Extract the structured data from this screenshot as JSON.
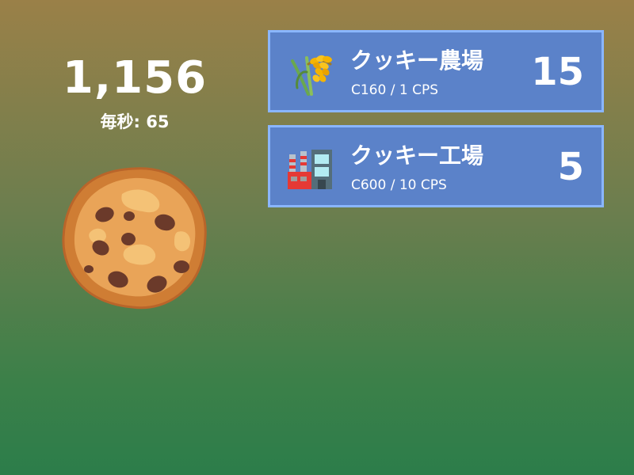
{
  "score": {
    "cookies": "1,156",
    "per_second_label": "毎秒: 65"
  },
  "big_cookie": {
    "icon": "cookie-icon"
  },
  "shop": {
    "buildings": [
      {
        "name": "クッキー農場",
        "cost_label": "C160 / 1 CPS",
        "owned": "15",
        "icon": "rice-sheaf-icon"
      },
      {
        "name": "クッキー工場",
        "cost_label": "C600 / 10 CPS",
        "owned": "5",
        "icon": "factory-icon"
      }
    ]
  },
  "colors": {
    "background_top": "#9a8048",
    "background_bottom": "#2c7d4a",
    "card_fill": "#5b82c9",
    "card_border": "#8ab6ff",
    "text": "#ffffff"
  }
}
